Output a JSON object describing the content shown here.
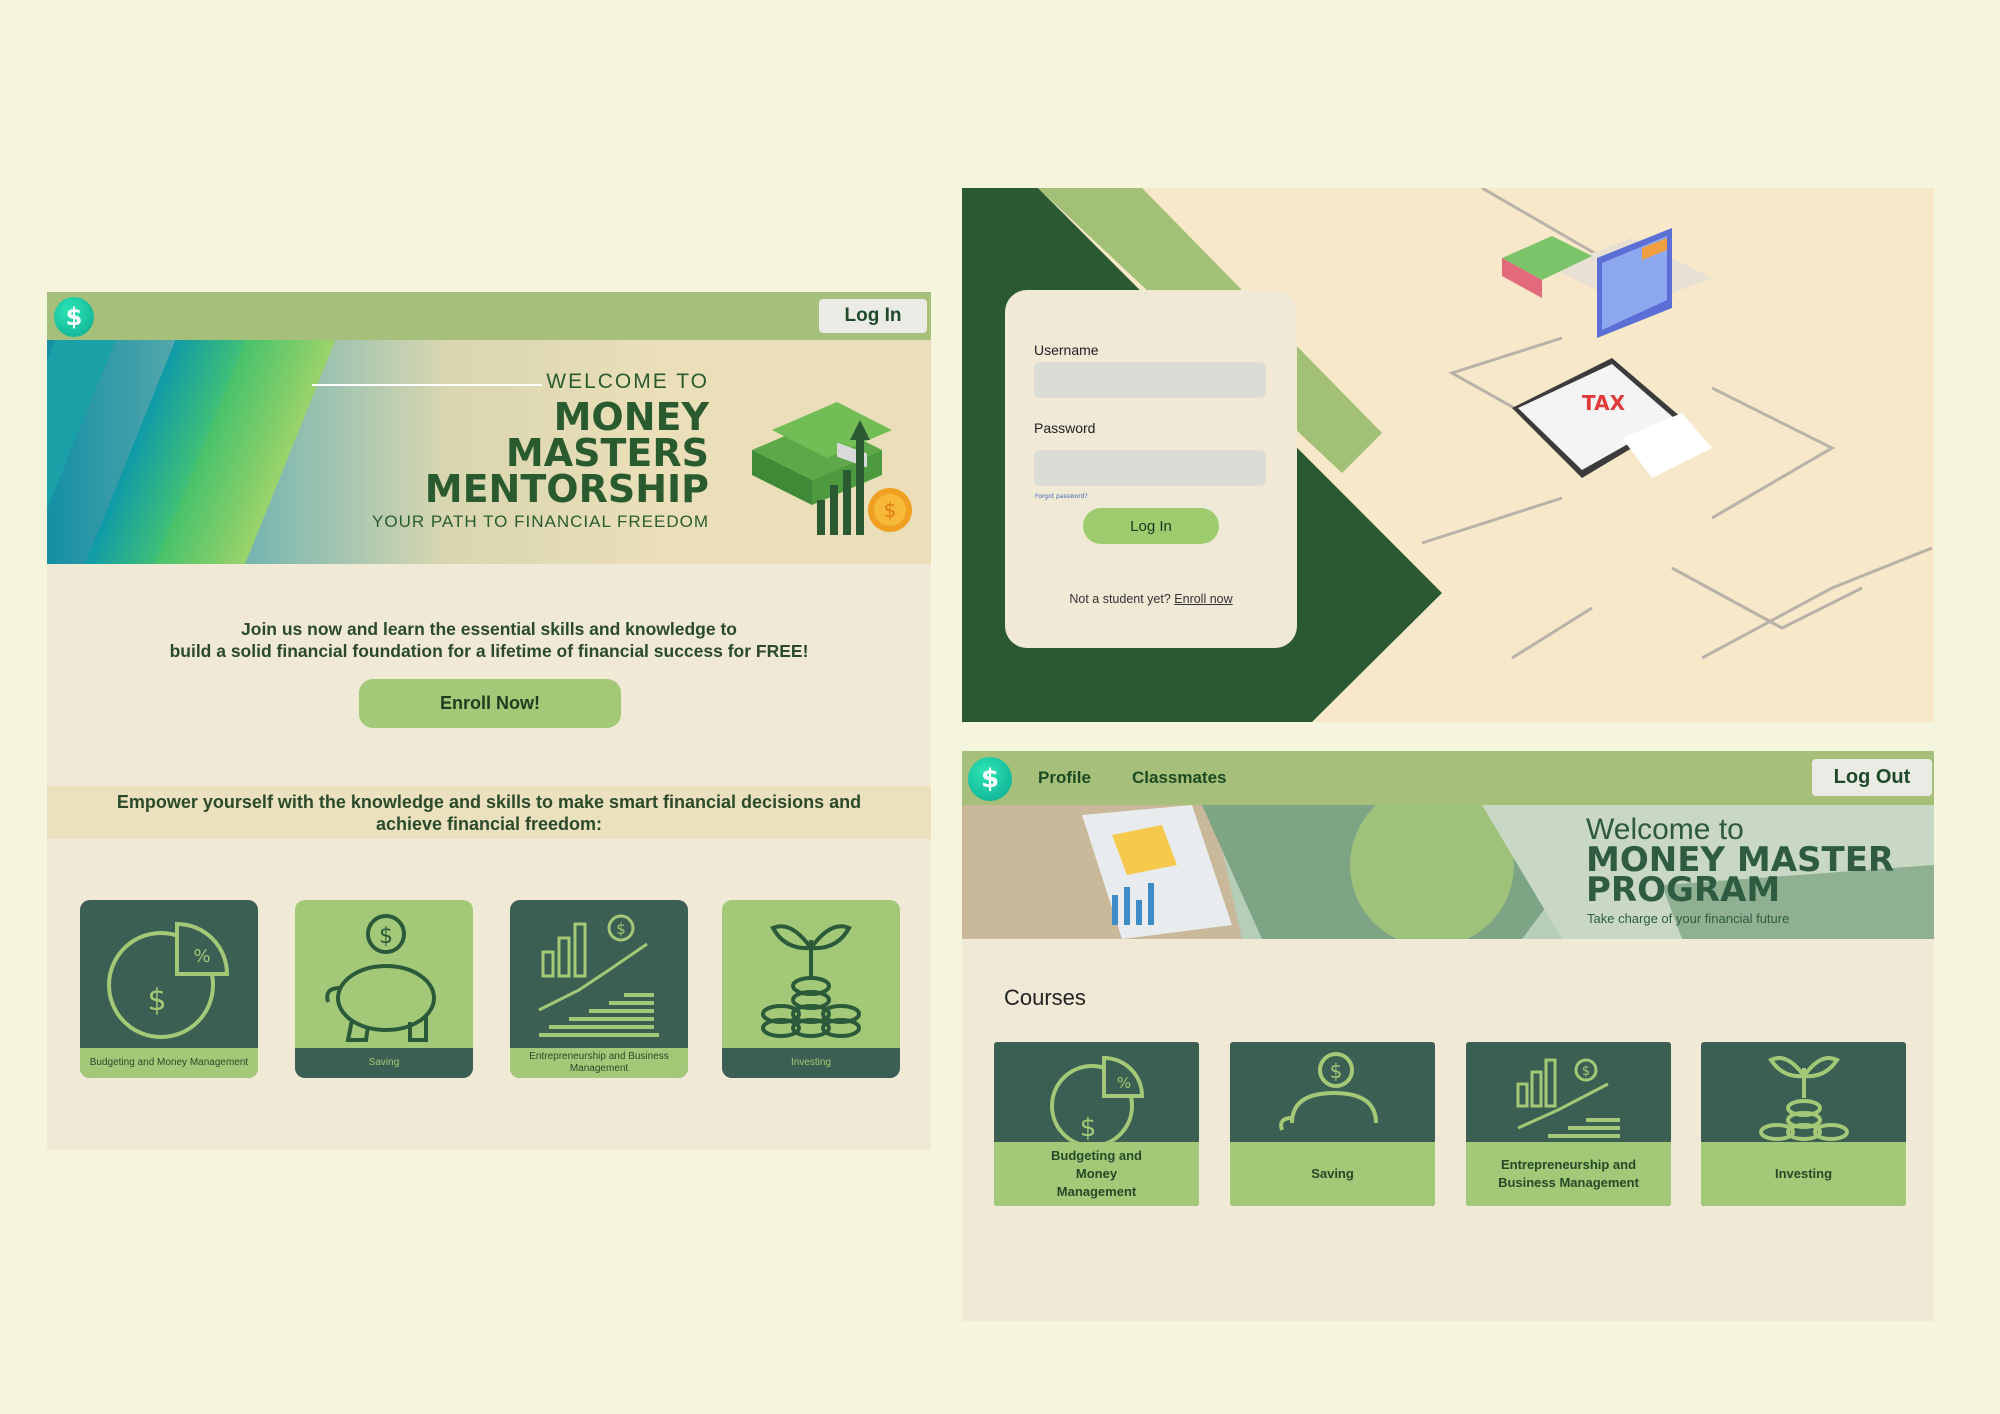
{
  "colors": {
    "page_bg": "#f4f5dc",
    "topbar": "#a6c07c",
    "dark_green": "#2b5a32",
    "tile_dark": "#3b5f52",
    "tile_light": "#a3c877",
    "panel_bg": "#f0e9d6"
  },
  "landing": {
    "logo_glyph": "$",
    "login_label": "Log In",
    "hero": {
      "welcome": "WELCOME TO",
      "line1": "MONEY",
      "line2": "MASTERS",
      "line3": "MENTORSHIP",
      "subtitle": "YOUR PATH TO FINANCIAL FREEDOM"
    },
    "join_line1": "Join us now and learn the essential skills and knowledge to",
    "join_line2": "build a solid financial foundation for a lifetime of financial success for FREE!",
    "enroll_label": "Enroll Now!",
    "empower_line1": "Empower yourself with the knowledge and skills to make smart financial decisions and",
    "empower_line2": "achieve financial freedom:",
    "courses": [
      {
        "label": "Budgeting and Money Management",
        "icon": "budget-pie-icon"
      },
      {
        "label": "Saving",
        "icon": "piggy-bank-icon"
      },
      {
        "label": "Entrepreneurship and Business Management",
        "icon": "growth-chart-icon"
      },
      {
        "label": "Investing",
        "icon": "coin-plant-icon"
      }
    ]
  },
  "login": {
    "username_label": "Username",
    "password_label": "Password",
    "forgot_label": "Forgot password?",
    "login_button": "Log In",
    "not_student": "Not a student yet?",
    "enroll_link": "Enroll now",
    "illustration_tag": "TAX"
  },
  "dashboard": {
    "logo_glyph": "$",
    "nav": [
      "Profile",
      "Classmates"
    ],
    "logout_label": "Log Out",
    "hero": {
      "welcome": "Welcome to",
      "line1": "MONEY MASTER",
      "line2": "PROGRAM",
      "tagline": "Take charge of your financial future"
    },
    "courses_heading": "Courses",
    "courses": [
      {
        "label_lines": [
          "Budgeting and",
          "Money",
          "Management"
        ],
        "icon": "budget-pie-icon"
      },
      {
        "label_lines": [
          "Saving"
        ],
        "icon": "piggy-bank-icon"
      },
      {
        "label_lines": [
          "Entrepreneurship and",
          "Business Management"
        ],
        "icon": "growth-chart-icon"
      },
      {
        "label_lines": [
          "Investing"
        ],
        "icon": "coin-plant-icon"
      }
    ]
  }
}
